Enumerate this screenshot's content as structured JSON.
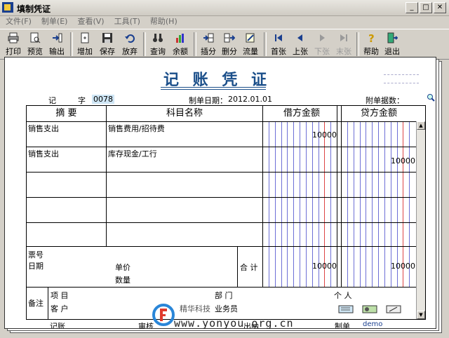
{
  "window": {
    "title": "填制凭证"
  },
  "menu": [
    "文件(F)",
    "制单(E)",
    "查看(V)",
    "工具(T)",
    "帮助(H)"
  ],
  "toolbar": {
    "print": "打印",
    "preview": "预览",
    "export": "输出",
    "add": "增加",
    "save": "保存",
    "discard": "放弃",
    "query": "查询",
    "balance": "余额",
    "insert_row": "插分",
    "delete_row": "删分",
    "flow": "流量",
    "first": "首张",
    "prev": "上张",
    "next": "下张",
    "last": "末张",
    "help": "帮助",
    "exit": "退出"
  },
  "voucher": {
    "title": "记 账 凭 证",
    "type_label": "记",
    "number_label": "字",
    "number": "0078",
    "date_label": "制单日期：",
    "date": "2012.01.01",
    "attachments_label": "附单据数：",
    "col_summary": "摘  要",
    "col_account": "科目名称",
    "col_debit": "借方金额",
    "col_credit": "贷方金额",
    "rows": [
      {
        "summary": "销售支出",
        "account": "销售费用/招待费",
        "debit": "10000",
        "credit": ""
      },
      {
        "summary": "销售支出",
        "account": "库存现金/工行",
        "debit": "",
        "credit": "10000"
      }
    ],
    "ticket_no_label": "票号",
    "date_row_label": "日期",
    "price_label": "单价",
    "qty_label": "数量",
    "total_label": "合 计",
    "total_debit": "10000",
    "total_credit": "10000",
    "note_label": "备注",
    "project_label": "项  目",
    "customer_label": "客  户",
    "dept_label": "部  门",
    "person_label": "个  人",
    "salesman_label": "业务员",
    "footer": {
      "bookkeeping": "记账",
      "review": "审核",
      "cashier": "出纳",
      "maker": "制单",
      "maker_name": "demo"
    }
  },
  "watermark": {
    "url": "www.yonyou.org.cn",
    "brand": "精华科技"
  }
}
